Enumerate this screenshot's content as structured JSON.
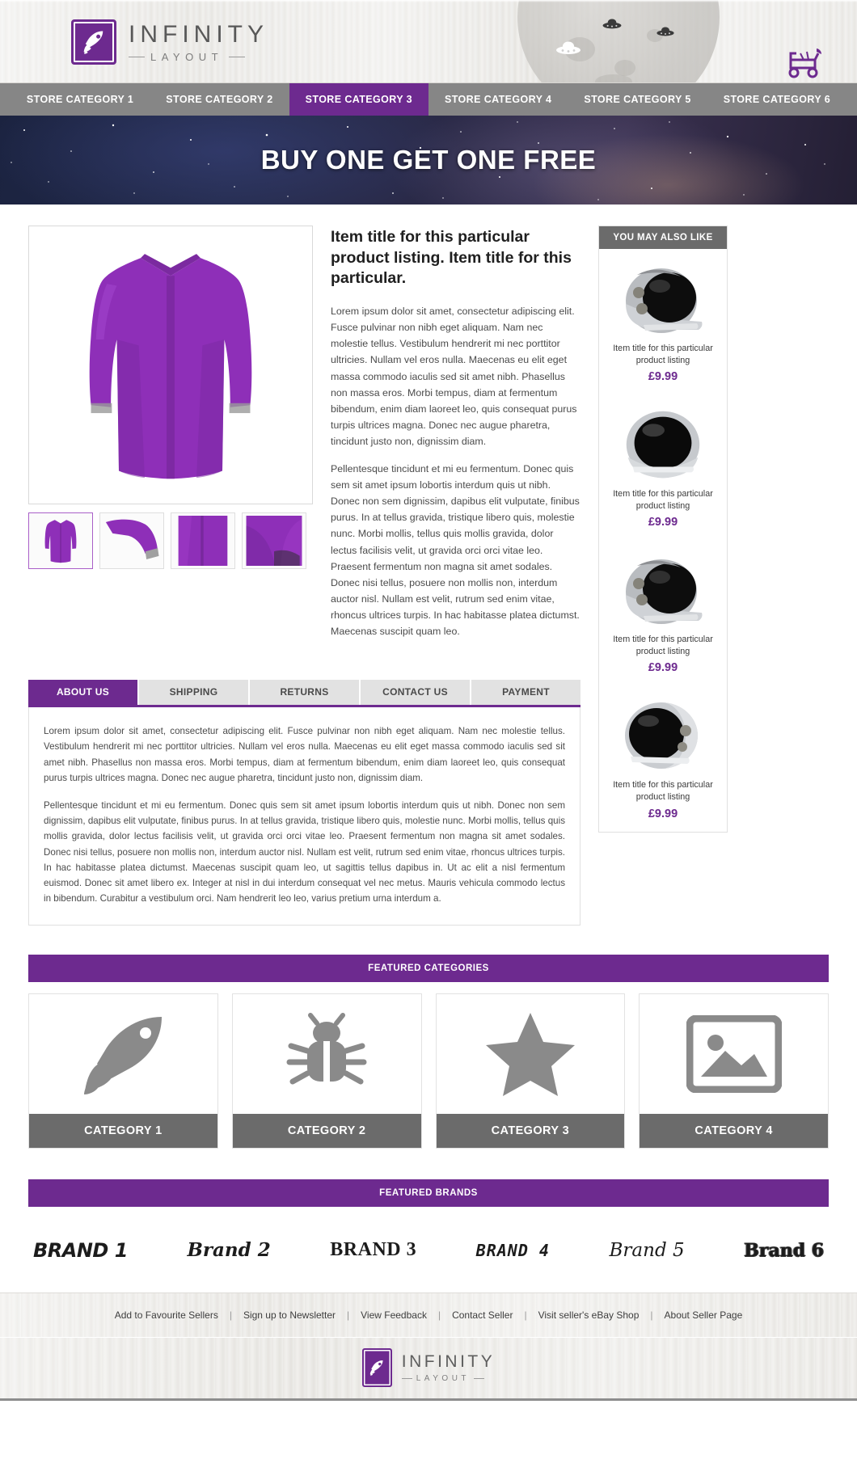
{
  "brand": {
    "logo_title": "INFINITY",
    "logo_sub": "LAYOUT",
    "accent_color": "#6d2a8f",
    "gray_color": "#6b6b6b"
  },
  "nav": {
    "items": [
      {
        "label": "STORE CATEGORY 1",
        "active": false
      },
      {
        "label": "STORE CATEGORY 2",
        "active": false
      },
      {
        "label": "STORE CATEGORY 3",
        "active": true
      },
      {
        "label": "STORE CATEGORY 4",
        "active": false
      },
      {
        "label": "STORE CATEGORY 5",
        "active": false
      },
      {
        "label": "STORE CATEGORY 6",
        "active": false
      }
    ]
  },
  "banner": {
    "headline": "BUY ONE GET ONE FREE"
  },
  "product": {
    "title": "Item title for this particular product listing. Item title for this particular.",
    "paragraph_1": "Lorem ipsum dolor sit amet, consectetur adipiscing elit. Fusce pulvinar non nibh eget aliquam. Nam nec molestie tellus. Vestibulum hendrerit mi nec porttitor ultricies. Nullam vel eros nulla. Maecenas eu elit eget massa commodo iaculis sed sit amet nibh. Phasellus non massa eros. Morbi tempus, diam at fermentum bibendum, enim diam laoreet leo, quis consequat purus turpis ultrices magna. Donec nec augue pharetra, tincidunt justo non, dignissim diam.",
    "paragraph_2": "Pellentesque tincidunt et mi eu fermentum. Donec quis sem sit amet ipsum lobortis interdum quis ut nibh. Donec non sem dignissim, dapibus elit vulputate, finibus purus. In at tellus gravida, tristique libero quis, molestie nunc. Morbi mollis, tellus quis mollis gravida, dolor lectus facilisis velit, ut gravida orci orci vitae leo. Praesent fermentum non magna sit amet sodales. Donec nisi tellus, posuere non mollis non, interdum auctor nisl. Nullam est velit, rutrum sed enim vitae, rhoncus ultrices turpis. In hac habitasse platea dictumst. Maecenas suscipit quam leo.",
    "thumbnails": [
      {
        "label": "thumbnail-1",
        "active": true
      },
      {
        "label": "thumbnail-2",
        "active": false
      },
      {
        "label": "thumbnail-3",
        "active": false
      },
      {
        "label": "thumbnail-4",
        "active": false
      }
    ]
  },
  "tabs": {
    "items": [
      {
        "label": "ABOUT US",
        "active": true
      },
      {
        "label": "SHIPPING",
        "active": false
      },
      {
        "label": "RETURNS",
        "active": false
      },
      {
        "label": "CONTACT US",
        "active": false
      },
      {
        "label": "PAYMENT",
        "active": false
      }
    ],
    "panel_paragraph_1": "Lorem ipsum dolor sit amet, consectetur adipiscing elit. Fusce pulvinar non nibh eget aliquam. Nam nec molestie tellus. Vestibulum hendrerit mi nec porttitor ultricies. Nullam vel eros nulla. Maecenas eu elit eget massa commodo iaculis sed sit amet nibh. Phasellus non massa eros. Morbi tempus, diam at fermentum bibendum, enim diam laoreet leo, quis consequat purus turpis ultrices magna. Donec nec augue pharetra, tincidunt justo non, dignissim diam.",
    "panel_paragraph_2": "Pellentesque tincidunt et mi eu fermentum. Donec quis sem sit amet ipsum lobortis interdum quis ut nibh. Donec non sem dignissim, dapibus elit vulputate, finibus purus. In at tellus gravida, tristique libero quis, molestie nunc. Morbi mollis, tellus quis mollis gravida, dolor lectus facilisis velit, ut gravida orci orci vitae leo. Praesent fermentum non magna sit amet sodales. Donec nisi tellus, posuere non mollis non, interdum auctor nisl. Nullam est velit, rutrum sed enim vitae, rhoncus ultrices turpis. In hac habitasse platea dictumst. Maecenas suscipit quam leo, ut sagittis tellus dapibus in. Ut ac elit a nisl fermentum euismod. Donec sit amet libero ex. Integer at nisl in dui interdum consequat vel nec metus. Mauris vehicula commodo lectus in bibendum. Curabitur a vestibulum orci. Nam hendrerit leo leo, varius pretium urna interdum a."
  },
  "sidebar": {
    "title": "YOU MAY ALSO LIKE",
    "items": [
      {
        "title": "Item title for this particular product listing",
        "price": "£9.99",
        "icon": "astronaut-helmet-icon"
      },
      {
        "title": "Item title for this particular product listing",
        "price": "£9.99",
        "icon": "astronaut-helmet-icon"
      },
      {
        "title": "Item title for this particular product listing",
        "price": "£9.99",
        "icon": "astronaut-helmet-icon"
      },
      {
        "title": "Item title for this particular product listing",
        "price": "£9.99",
        "icon": "astronaut-helmet-icon"
      }
    ]
  },
  "featured_categories": {
    "heading": "FEATURED CATEGORIES",
    "items": [
      {
        "label": "CATEGORY 1",
        "icon": "rocket-icon"
      },
      {
        "label": "CATEGORY 2",
        "icon": "bug-icon"
      },
      {
        "label": "CATEGORY 3",
        "icon": "star-icon"
      },
      {
        "label": "CATEGORY 4",
        "icon": "image-placeholder-icon"
      }
    ]
  },
  "featured_brands": {
    "heading": "FEATURED BRANDS",
    "items": [
      {
        "label": "BRAND 1"
      },
      {
        "label": "Brand 2"
      },
      {
        "label": "BRAND 3"
      },
      {
        "label": "BRAND 4"
      },
      {
        "label": "Brand 5"
      },
      {
        "label": "Brand 6"
      }
    ]
  },
  "footer": {
    "links": [
      {
        "label": "Add to Favourite Sellers"
      },
      {
        "label": "Sign up to Newsletter"
      },
      {
        "label": "View Feedback"
      },
      {
        "label": "Contact Seller"
      },
      {
        "label": "Visit seller's eBay Shop"
      },
      {
        "label": "About Seller Page"
      }
    ],
    "separator": "|",
    "logo_title": "INFINITY",
    "logo_sub": "LAYOUT"
  }
}
